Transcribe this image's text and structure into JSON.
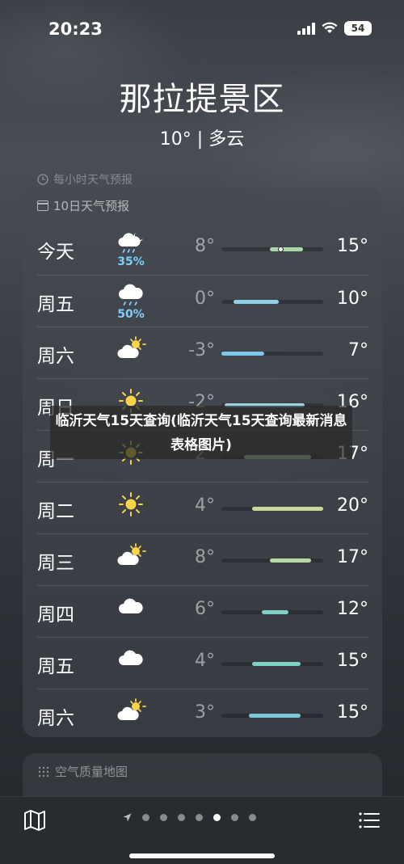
{
  "status": {
    "time": "20:23",
    "battery": "54"
  },
  "header": {
    "location": "那拉提景区",
    "summary": "10° | 多云"
  },
  "hourly": {
    "title": "每小时天气预报"
  },
  "forecast": {
    "title": "10日天气预报",
    "days": [
      {
        "day": "今天",
        "icon": "partly-cloudy-night-rain-icon",
        "pop": "35%",
        "low": "8°",
        "high": "15°",
        "bar_from": 0.48,
        "bar_to": 0.8,
        "bar_color": "#a7d8a8",
        "current": 0.58
      },
      {
        "day": "周五",
        "icon": "rain-cloud-icon",
        "pop": "50%",
        "low": "0°",
        "high": "10°",
        "bar_from": 0.12,
        "bar_to": 0.56,
        "bar_color": "#8fd0e8"
      },
      {
        "day": "周六",
        "icon": "partly-sunny-icon",
        "pop": "",
        "low": "-3°",
        "high": "7°",
        "bar_from": 0.0,
        "bar_to": 0.42,
        "bar_color": "#7cc7ec"
      },
      {
        "day": "周日",
        "icon": "sun-icon",
        "pop": "",
        "low": "-2°",
        "high": "16°",
        "bar_from": 0.03,
        "bar_to": 0.82,
        "bar_color": "#9fd0e0"
      },
      {
        "day": "周一",
        "icon": "sun-icon",
        "pop": "",
        "low": "2°",
        "high": "17°",
        "bar_from": 0.22,
        "bar_to": 0.88,
        "bar_color": "#b4d4b4"
      },
      {
        "day": "周二",
        "icon": "sun-icon",
        "pop": "",
        "low": "4°",
        "high": "20°",
        "bar_from": 0.3,
        "bar_to": 1.0,
        "bar_color": "#c8d89a"
      },
      {
        "day": "周三",
        "icon": "partly-sunny-icon",
        "pop": "",
        "low": "8°",
        "high": "17°",
        "bar_from": 0.48,
        "bar_to": 0.88,
        "bar_color": "#b8d8a8"
      },
      {
        "day": "周四",
        "icon": "cloud-icon",
        "pop": "",
        "low": "6°",
        "high": "12°",
        "bar_from": 0.4,
        "bar_to": 0.66,
        "bar_color": "#7fd0c8"
      },
      {
        "day": "周五",
        "icon": "cloud-icon",
        "pop": "",
        "low": "4°",
        "high": "15°",
        "bar_from": 0.3,
        "bar_to": 0.78,
        "bar_color": "#7fd0c8"
      },
      {
        "day": "周六",
        "icon": "partly-sunny-icon",
        "pop": "",
        "low": "3°",
        "high": "15°",
        "bar_from": 0.27,
        "bar_to": 0.78,
        "bar_color": "#7cc8d8"
      }
    ]
  },
  "overlay": {
    "text": "临沂天气15天查询(临沂天气15天查询最新消息表格图片)"
  },
  "aqi": {
    "title": "空气质量地图"
  },
  "bottom": {
    "pages": 8,
    "active_page": 5
  }
}
